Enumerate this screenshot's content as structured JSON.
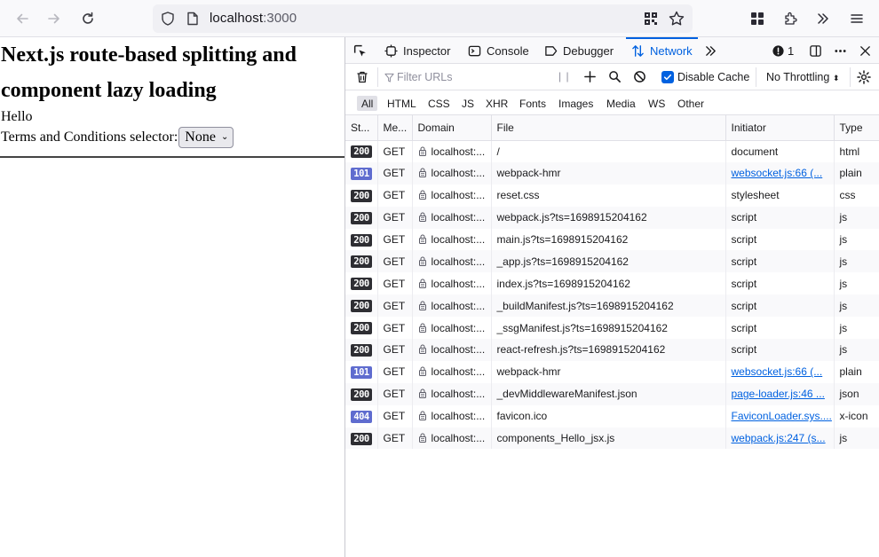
{
  "browser": {
    "url_host": "localhost",
    "url_port": ":3000"
  },
  "page": {
    "title": "Next.js route-based splitting and component lazy loading",
    "hello": "Hello",
    "terms_label": "Terms and Conditions selector:",
    "select_value": "None"
  },
  "devtools": {
    "tabs": {
      "inspector": "Inspector",
      "console": "Console",
      "debugger": "Debugger",
      "network": "Network"
    },
    "error_count": "1",
    "filter_placeholder": "Filter URLs",
    "disable_cache_label": "Disable Cache",
    "throttling_label": "No Throttling",
    "type_filters": [
      "All",
      "HTML",
      "CSS",
      "JS",
      "XHR",
      "Fonts",
      "Images",
      "Media",
      "WS",
      "Other"
    ],
    "columns": [
      "St...",
      "Me...",
      "Domain",
      "File",
      "Initiator",
      "Type"
    ],
    "rows": [
      {
        "status": "200",
        "method": "GET",
        "domain": "localhost:...",
        "file": "/",
        "initiator": "document",
        "initiator_link": false,
        "type": "html"
      },
      {
        "status": "101",
        "method": "GET",
        "domain": "localhost:...",
        "file": "webpack-hmr",
        "initiator": "websocket.js:66 (...",
        "initiator_link": true,
        "type": "plain"
      },
      {
        "status": "200",
        "method": "GET",
        "domain": "localhost:...",
        "file": "reset.css",
        "initiator": "stylesheet",
        "initiator_link": false,
        "type": "css"
      },
      {
        "status": "200",
        "method": "GET",
        "domain": "localhost:...",
        "file": "webpack.js?ts=1698915204162",
        "initiator": "script",
        "initiator_link": false,
        "type": "js"
      },
      {
        "status": "200",
        "method": "GET",
        "domain": "localhost:...",
        "file": "main.js?ts=1698915204162",
        "initiator": "script",
        "initiator_link": false,
        "type": "js"
      },
      {
        "status": "200",
        "method": "GET",
        "domain": "localhost:...",
        "file": "_app.js?ts=1698915204162",
        "initiator": "script",
        "initiator_link": false,
        "type": "js"
      },
      {
        "status": "200",
        "method": "GET",
        "domain": "localhost:...",
        "file": "index.js?ts=1698915204162",
        "initiator": "script",
        "initiator_link": false,
        "type": "js"
      },
      {
        "status": "200",
        "method": "GET",
        "domain": "localhost:...",
        "file": "_buildManifest.js?ts=1698915204162",
        "initiator": "script",
        "initiator_link": false,
        "type": "js"
      },
      {
        "status": "200",
        "method": "GET",
        "domain": "localhost:...",
        "file": "_ssgManifest.js?ts=1698915204162",
        "initiator": "script",
        "initiator_link": false,
        "type": "js"
      },
      {
        "status": "200",
        "method": "GET",
        "domain": "localhost:...",
        "file": "react-refresh.js?ts=1698915204162",
        "initiator": "script",
        "initiator_link": false,
        "type": "js"
      },
      {
        "status": "101",
        "method": "GET",
        "domain": "localhost:...",
        "file": "webpack-hmr",
        "initiator": "websocket.js:66 (...",
        "initiator_link": true,
        "type": "plain"
      },
      {
        "status": "200",
        "method": "GET",
        "domain": "localhost:...",
        "file": "_devMiddlewareManifest.json",
        "initiator": "page-loader.js:46 ...",
        "initiator_link": true,
        "type": "json"
      },
      {
        "status": "404",
        "method": "GET",
        "domain": "localhost:...",
        "file": "favicon.ico",
        "initiator": "FaviconLoader.sys....",
        "initiator_link": true,
        "type": "x-icon"
      },
      {
        "status": "200",
        "method": "GET",
        "domain": "localhost:...",
        "file": "components_Hello_jsx.js",
        "initiator": "webpack.js:247 (s...",
        "initiator_link": true,
        "type": "js"
      }
    ]
  },
  "colors": {
    "status_200": "#2e2e33",
    "status_101": "#5f6ccf",
    "status_404": "#5f6ccf",
    "accent": "#0061e0"
  },
  "icons": {
    "back": "back-arrow-icon",
    "forward": "forward-arrow-icon",
    "reload": "reload-icon",
    "shield": "shield-icon",
    "page": "page-icon",
    "qr": "qr-code-icon",
    "bookmark": "star-icon",
    "extensions": "extensions-icon",
    "puzzle": "puzzle-icon",
    "overflow": "chevrons-right-icon",
    "menu": "hamburger-menu-icon",
    "lock": "lock-icon"
  }
}
